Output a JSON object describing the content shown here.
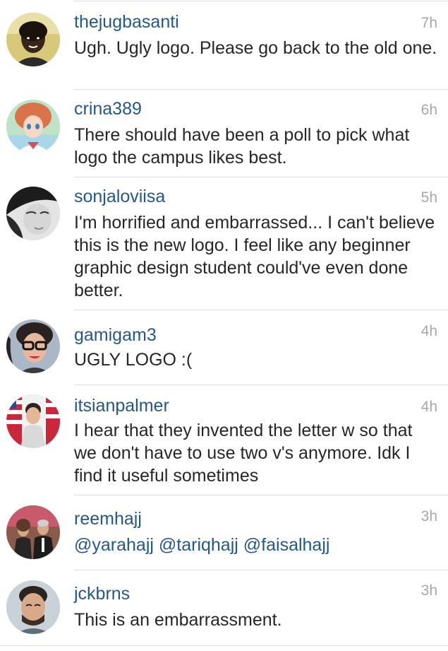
{
  "comments": [
    {
      "username": "thejugbasanti",
      "time": "7h",
      "text": "Ugh. Ugly logo. Please go back to the old one.",
      "avatar_icon": "user-avatar-photo"
    },
    {
      "username": "crina389",
      "time": "6h",
      "text": "There should have been a  poll to pick what logo the campus likes best.",
      "avatar_icon": "cartoon-avatar-photo"
    },
    {
      "username": "sonjaloviisa",
      "time": "5h",
      "text": "I'm horrified and embarrassed... I can't believe this is the new logo. I feel like any beginner graphic design student could've even done better.",
      "avatar_icon": "bw-portrait-photo"
    },
    {
      "username": "gamigam3",
      "time": "4h",
      "text": "UGLY LOGO :(",
      "avatar_icon": "glasses-portrait-photo"
    },
    {
      "username": "itsianpalmer",
      "time": "4h",
      "text": "I hear that they invented the letter w so that we don't have to use two v's anymore. Idk I find it useful sometimes",
      "avatar_icon": "flag-portrait-photo"
    },
    {
      "username": "reemhajj",
      "time": "3h",
      "mentions": [
        "@yarahajj",
        "@tariqhajj",
        "@faisalhajj"
      ],
      "avatar_icon": "group-photo"
    },
    {
      "username": "jckbrns",
      "time": "3h",
      "text": "This is an embarrassment.",
      "avatar_icon": "portrait-photo"
    }
  ],
  "colors": {
    "username": "#24578a",
    "mention": "#24578a",
    "body_text": "#262626",
    "timestamp": "#a7a7a7",
    "divider": "#dedede"
  }
}
